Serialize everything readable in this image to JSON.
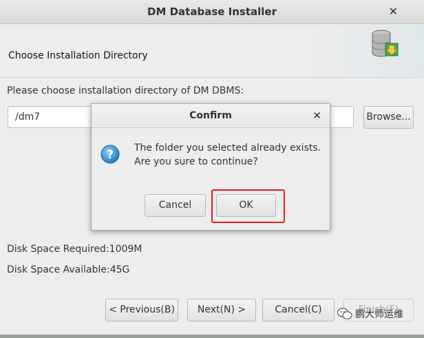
{
  "window": {
    "title": "DM Database Installer",
    "close_glyph": "✕"
  },
  "header": {
    "title": "Choose Installation Directory",
    "icon": "database-install-icon"
  },
  "form": {
    "prompt": "Please choose installation directory of DM DBMS:",
    "path_value": "/dm7",
    "browse_label": "Browse..."
  },
  "disk": {
    "required": "Disk Space Required:1009M",
    "available": "Disk Space Available:45G"
  },
  "nav": {
    "previous": "< Previous(B)",
    "next": "Next(N) >",
    "cancel": "Cancel(C)",
    "finish": "Finish(F)"
  },
  "dialog": {
    "title": "Confirm",
    "close_glyph": "✕",
    "message_line1": "The folder you selected already exists.",
    "message_line2": "Are you sure to continue?",
    "cancel_label": "Cancel",
    "ok_label": "OK",
    "highlight_color": "#e01e1e"
  },
  "watermark": {
    "text": "鹏大师运维"
  }
}
